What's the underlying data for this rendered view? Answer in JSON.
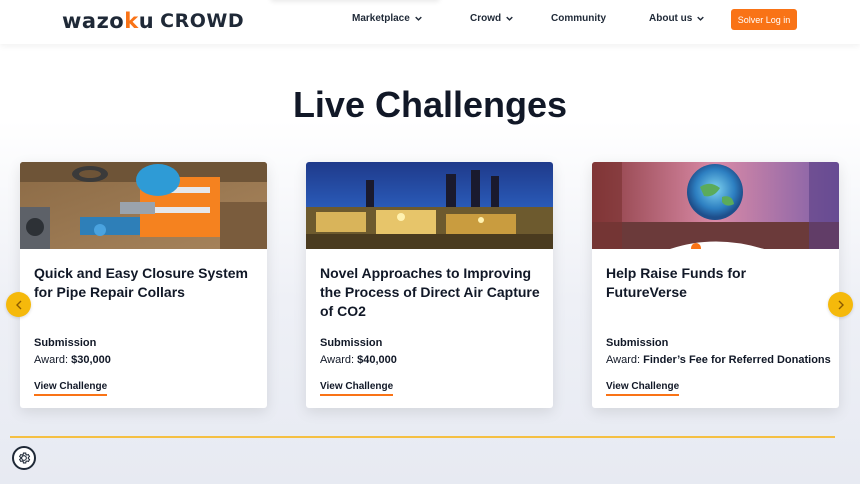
{
  "header": {
    "logo_left": "wazo",
    "logo_k": "k",
    "logo_u": "u",
    "logo_right": "CROWD",
    "nav": [
      {
        "label": "Marketplace",
        "has_dropdown": true
      },
      {
        "label": "Crowd",
        "has_dropdown": true
      },
      {
        "label": "Community",
        "has_dropdown": false
      },
      {
        "label": "About us",
        "has_dropdown": true
      }
    ],
    "login_label": "Solver Log in"
  },
  "main": {
    "title": "Live Challenges",
    "cards": [
      {
        "title": "Quick and Easy Closure System for Pipe Repair Collars",
        "status": "Submission",
        "award_label": "Award:",
        "award_value": "$30,000",
        "link_label": "View Challenge",
        "image": "worker-pipe-repair-photo"
      },
      {
        "title": "Novel Approaches to Improving the Process of Direct Air Capture of CO2",
        "status": "Submission",
        "award_label": "Award:",
        "award_value": "$40,000",
        "link_label": "View Challenge",
        "image": "industrial-plant-night-photo"
      },
      {
        "title": "Help Raise Funds for FutureVerse",
        "status": "Submission",
        "award_label": "Award:",
        "award_value": "Finder’s Fee for Referred Donations",
        "link_label": "View Challenge",
        "image": "futuristic-globe-hall-photo"
      }
    ]
  },
  "colors": {
    "accent": "#f97316",
    "arrow": "#f5b90b",
    "divider": "#f5c043",
    "text": "#111827"
  },
  "icons": {
    "prev": "chevron-left-icon",
    "next": "chevron-right-icon",
    "dropdown": "chevron-down-icon",
    "settings": "gear-icon"
  }
}
